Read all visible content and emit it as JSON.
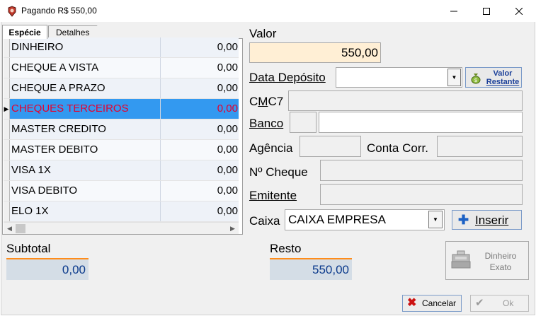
{
  "window": {
    "title": "Pagando R$ 550,00",
    "icon": "app-icon"
  },
  "tabs": [
    {
      "label": "Espécie",
      "active": true
    },
    {
      "label": "Detalhes",
      "active": false
    }
  ],
  "grid": {
    "rows": [
      {
        "name": "DINHEIRO",
        "value": "0,00",
        "selected": false
      },
      {
        "name": "CHEQUE A VISTA",
        "value": "0,00",
        "selected": false
      },
      {
        "name": "CHEQUE A PRAZO",
        "value": "0,00",
        "selected": false
      },
      {
        "name": "CHEQUES TERCEIROS",
        "value": "0,00",
        "selected": true
      },
      {
        "name": "MASTER CREDITO",
        "value": "0,00",
        "selected": false
      },
      {
        "name": "MASTER DEBITO",
        "value": "0,00",
        "selected": false
      },
      {
        "name": "VISA 1X",
        "value": "0,00",
        "selected": false
      },
      {
        "name": "VISA DEBITO",
        "value": "0,00",
        "selected": false
      },
      {
        "name": "ELO 1X",
        "value": "0,00",
        "selected": false
      }
    ],
    "selected_color": "#3399f0",
    "selected_text_color": "#e6002e"
  },
  "form": {
    "valor_label": "Valor",
    "valor_value": "550,00",
    "data_deposito_label": "Data Depósito",
    "data_deposito_value": "",
    "valor_restante_label_1": "Valor",
    "valor_restante_label_2": "Restante",
    "cmc7_label": "CMC7",
    "banco_label": "Banco",
    "agencia_label": "Agência",
    "conta_label": "Conta Corr.",
    "ncheque_label": "Nº Cheque",
    "emitente_label": "Emitente",
    "caixa_label": "Caixa",
    "caixa_value": "CAIXA EMPRESA",
    "inserir_label": "Inserir"
  },
  "totals": {
    "subtotal_label": "Subtotal",
    "subtotal_value": "0,00",
    "resto_label": "Resto",
    "resto_value": "550,00"
  },
  "buttons": {
    "dinheiro_exato_1": "Dinheiro",
    "dinheiro_exato_2": "Exato",
    "cancelar": "Cancelar",
    "ok": "Ok"
  },
  "colors": {
    "valor_bg": "#ffefd5",
    "total_accent": "#ff8c1a",
    "total_text": "#0b3a8c"
  }
}
